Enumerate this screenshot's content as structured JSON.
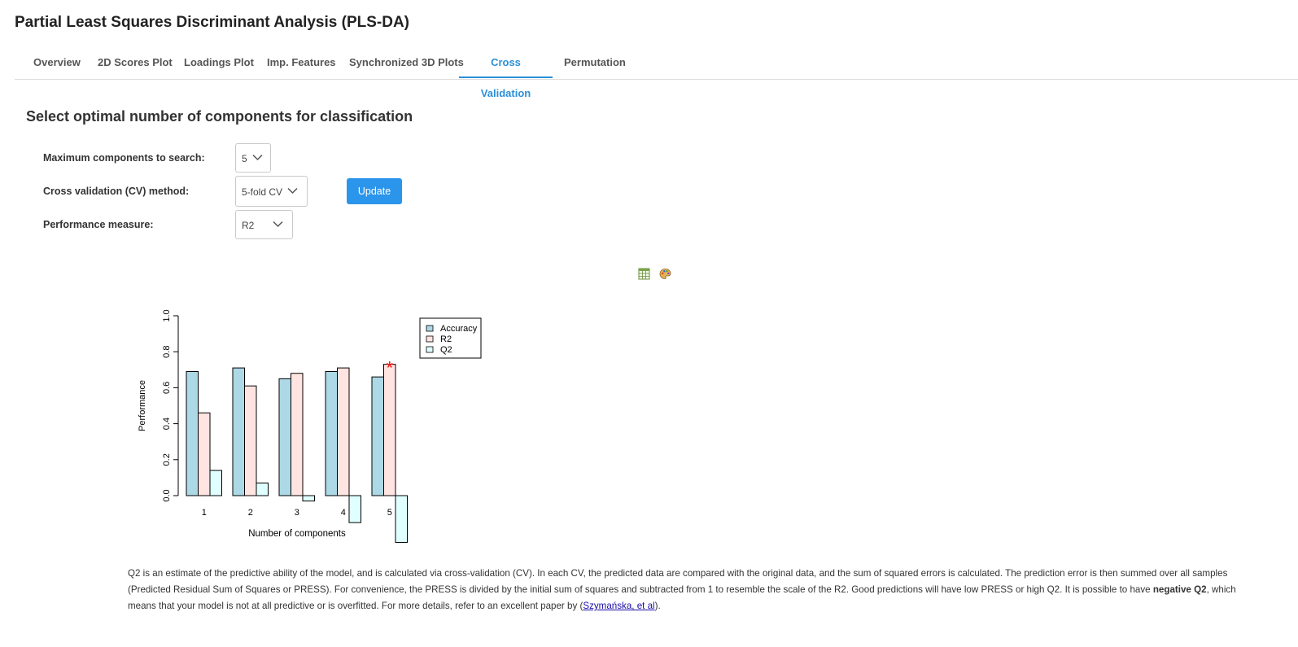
{
  "page": {
    "title": "Partial Least Squares Discriminant Analysis (PLS-DA)"
  },
  "tabs": [
    {
      "label": "Overview"
    },
    {
      "label": "2D Scores Plot"
    },
    {
      "label": "Loadings Plot"
    },
    {
      "label": "Imp. Features"
    },
    {
      "label": "Synchronized 3D Plots"
    },
    {
      "label": "Cross Validation",
      "active": true
    },
    {
      "label": "Permutation"
    }
  ],
  "section": {
    "title": "Select optimal number of components for classification"
  },
  "form": {
    "max_components": {
      "label": "Maximum components to search:",
      "value": "5"
    },
    "cv_method": {
      "label": "Cross validation (CV) method:",
      "value": "5-fold CV"
    },
    "performance": {
      "label": "Performance measure:",
      "value": "R2"
    },
    "update_label": "Update"
  },
  "toolbar": {
    "icons": [
      "table-icon",
      "palette-icon"
    ]
  },
  "chart_data": {
    "type": "bar",
    "categories": [
      "1",
      "2",
      "3",
      "4",
      "5"
    ],
    "series": [
      {
        "name": "Accuracy",
        "values": [
          0.69,
          0.71,
          0.65,
          0.69,
          0.66
        ],
        "color": "#add8e6"
      },
      {
        "name": "R2",
        "values": [
          0.46,
          0.61,
          0.68,
          0.71,
          0.73
        ],
        "color": "#ffe4e1"
      },
      {
        "name": "Q2",
        "values": [
          0.14,
          0.07,
          -0.03,
          -0.15,
          -0.26
        ],
        "color": "#e0ffff"
      }
    ],
    "xlabel": "Number of components",
    "ylabel": "Performance",
    "y_ticks": [
      "0.0",
      "0.2",
      "0.4",
      "0.6",
      "0.8",
      "1.0"
    ],
    "ylim": [
      -0.26,
      1.0
    ],
    "best_marker": {
      "category": "5",
      "series": "R2",
      "symbol": "*",
      "color": "#ff0000"
    },
    "legend_placement": "top-right",
    "grid": false
  },
  "description": {
    "part1": "Q2 is an estimate of the predictive ability of the model, and is calculated via cross-validation (CV). In each CV, the predicted data are compared with the original data, and the sum of squared errors is calculated. The prediction error is then summed over all samples (Predicted Residual Sum of Squares or PRESS). For convenience, the PRESS is divided by the initial sum of squares and subtracted from 1 to resemble the scale of the R2. Good predictions will have low PRESS or high Q2. It is possible to have ",
    "bold": "negative Q2",
    "part2": ", which means that your model is not at all predictive or is overfitted. For more details, refer to an excellent paper by (",
    "link": "Szymańska, et al",
    "part3": ")."
  }
}
